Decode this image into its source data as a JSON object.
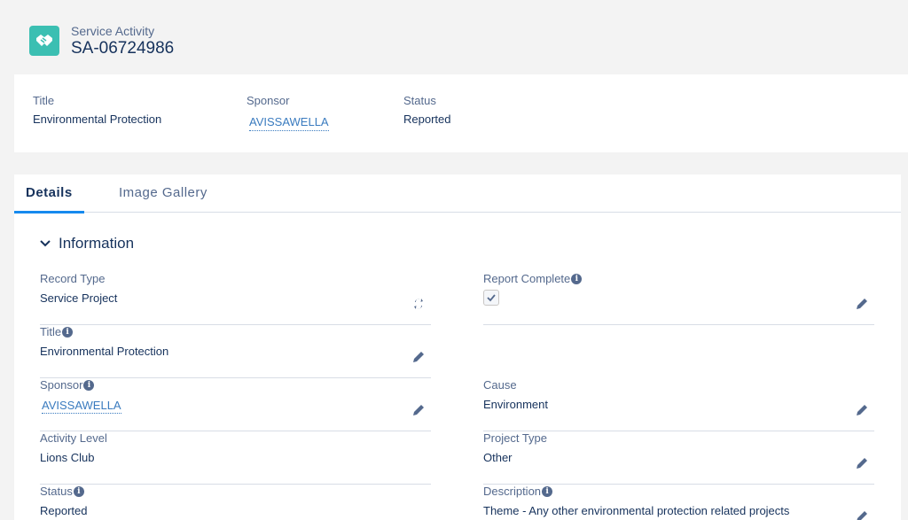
{
  "header": {
    "object_type": "Service Activity",
    "record_name": "SA-06724986",
    "icon": "handshake-icon",
    "icon_color": "#3bbfb2"
  },
  "highlights": {
    "title_label": "Title",
    "title_value": "Environmental Protection",
    "sponsor_label": "Sponsor",
    "sponsor_value": "AVISSAWELLA",
    "status_label": "Status",
    "status_value": "Reported"
  },
  "tabs": [
    {
      "label": "Details",
      "active": true
    },
    {
      "label": "Image Gallery",
      "active": false
    }
  ],
  "section": {
    "title": "Information"
  },
  "fields": {
    "record_type": {
      "label": "Record Type",
      "value": "Service Project"
    },
    "report_complete": {
      "label": "Report Complete",
      "checked": true
    },
    "title": {
      "label": "Title",
      "value": "Environmental Protection"
    },
    "sponsor": {
      "label": "Sponsor",
      "value": "AVISSAWELLA"
    },
    "cause": {
      "label": "Cause",
      "value": "Environment"
    },
    "activity_level": {
      "label": "Activity Level",
      "value": "Lions Club"
    },
    "project_type": {
      "label": "Project Type",
      "value": "Other"
    },
    "status": {
      "label": "Status",
      "value": "Reported"
    },
    "description": {
      "label": "Description",
      "value": "Theme - Any other environmental protection related projects"
    }
  },
  "colors": {
    "link": "#3a7bbf",
    "tab_active_indicator": "#1589ee",
    "label": "#54698d",
    "text": "#16325c"
  }
}
